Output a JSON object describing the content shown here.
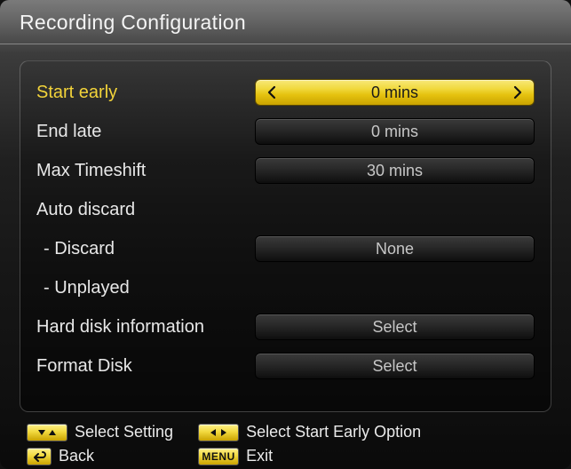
{
  "title": "Recording Configuration",
  "rows": {
    "start_early": {
      "label": "Start early",
      "value": "0 mins"
    },
    "end_late": {
      "label": "End late",
      "value": "0 mins"
    },
    "max_timeshift": {
      "label": "Max Timeshift",
      "value": "30 mins"
    },
    "auto_discard": {
      "label": "Auto discard"
    },
    "discard": {
      "label": "- Discard",
      "value": "None"
    },
    "unplayed": {
      "label": "- Unplayed"
    },
    "hdd_info": {
      "label": "Hard disk information",
      "value": "Select"
    },
    "format_disk": {
      "label": "Format Disk",
      "value": "Select"
    }
  },
  "footer": {
    "select_setting": "Select Setting",
    "back": "Back",
    "select_option": "Select Start Early Option",
    "exit": "Exit",
    "menu_key": "MENU"
  }
}
